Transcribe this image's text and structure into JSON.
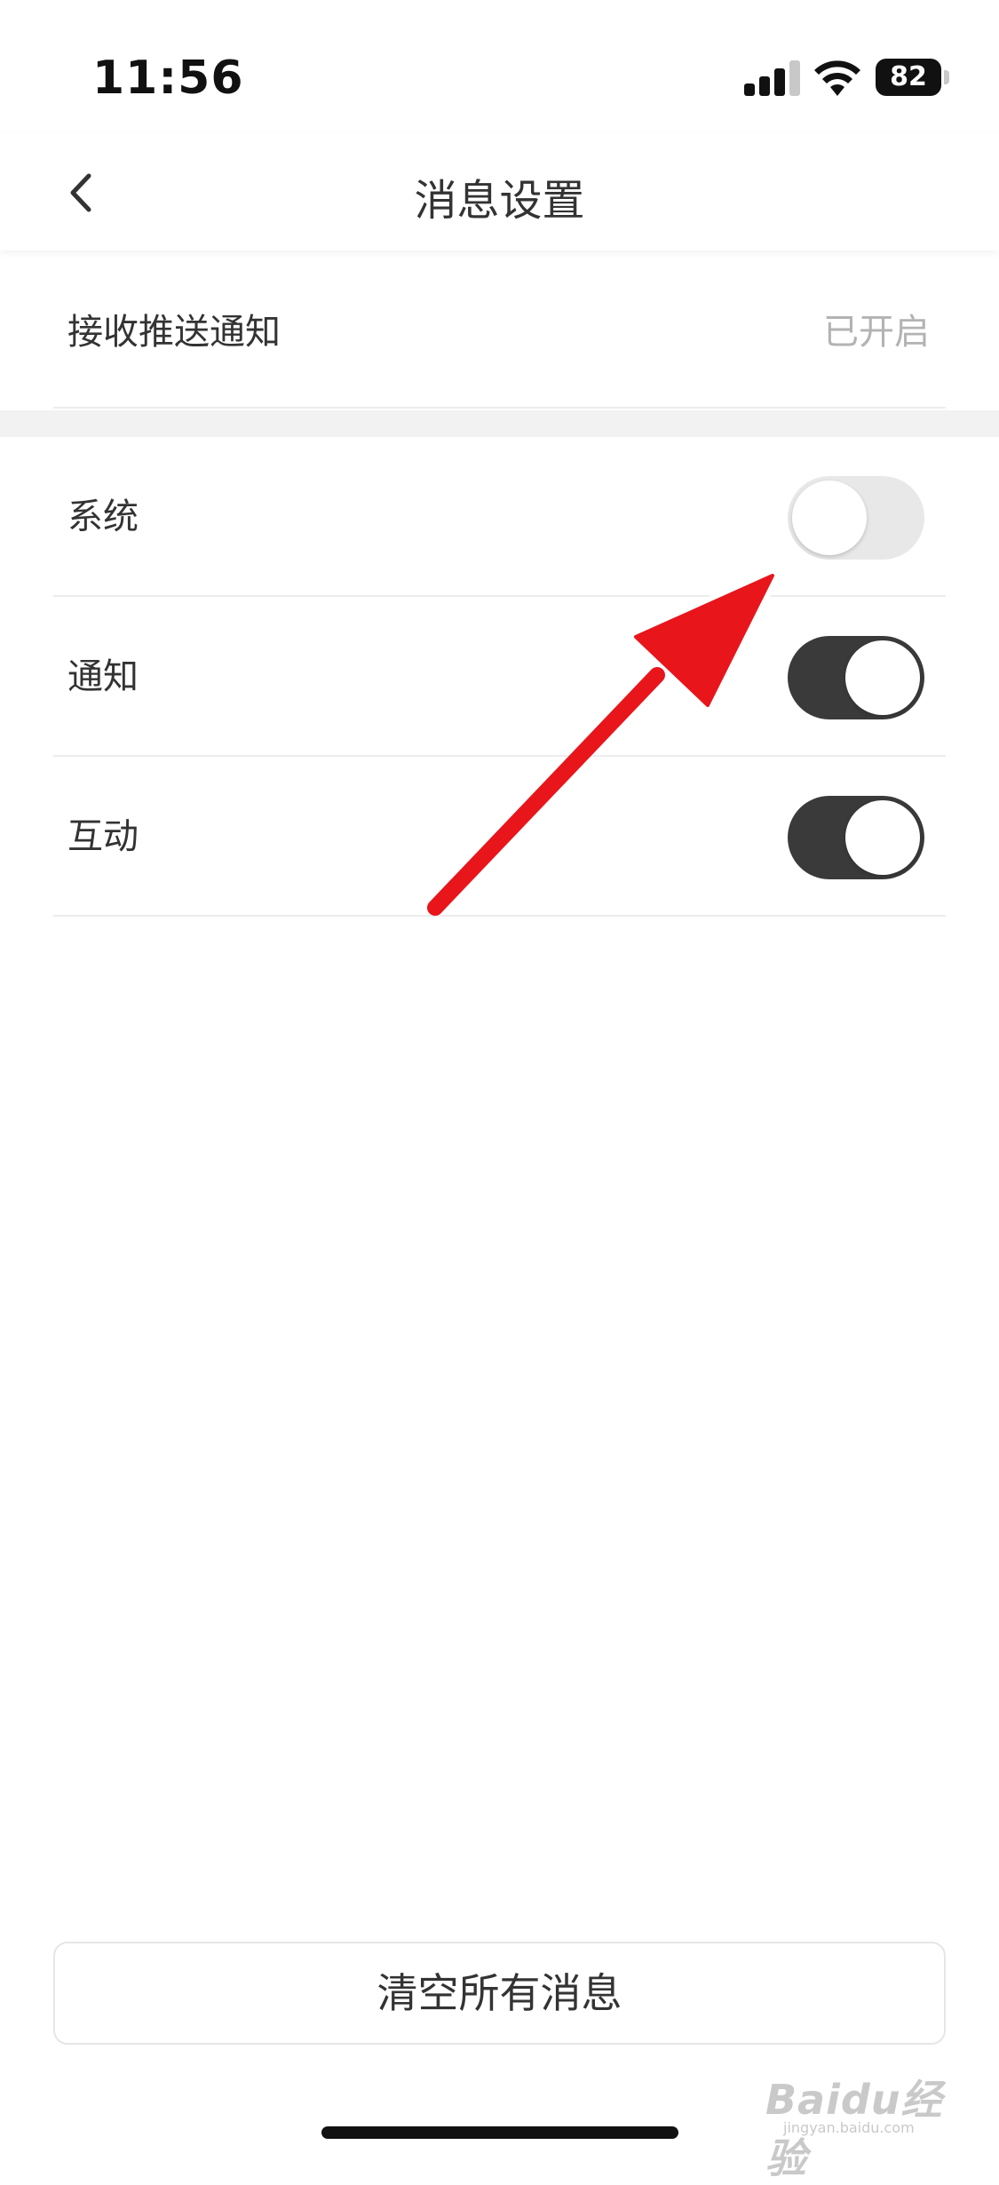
{
  "status_bar": {
    "time": "11:56",
    "battery": "82",
    "signal_icon": "cellular-signal-icon",
    "wifi_icon": "wifi-icon",
    "battery_icon": "battery-icon"
  },
  "nav": {
    "title": "消息设置",
    "back_icon": "chevron-left-icon"
  },
  "push": {
    "label": "接收推送通知",
    "value": "已开启"
  },
  "toggles": [
    {
      "label": "系统",
      "on": false
    },
    {
      "label": "通知",
      "on": true
    },
    {
      "label": "互动",
      "on": true
    }
  ],
  "clear_button": "清空所有消息",
  "annotation": {
    "icon": "red-arrow-annotation",
    "color": "#e8151b"
  },
  "watermark": {
    "logo": "Baidu经验",
    "url": "jingyan.baidu.com"
  },
  "colors": {
    "toggle_on": "#3a3a3a",
    "toggle_off": "#e8e8e8",
    "value_text": "#b3b3b3"
  }
}
